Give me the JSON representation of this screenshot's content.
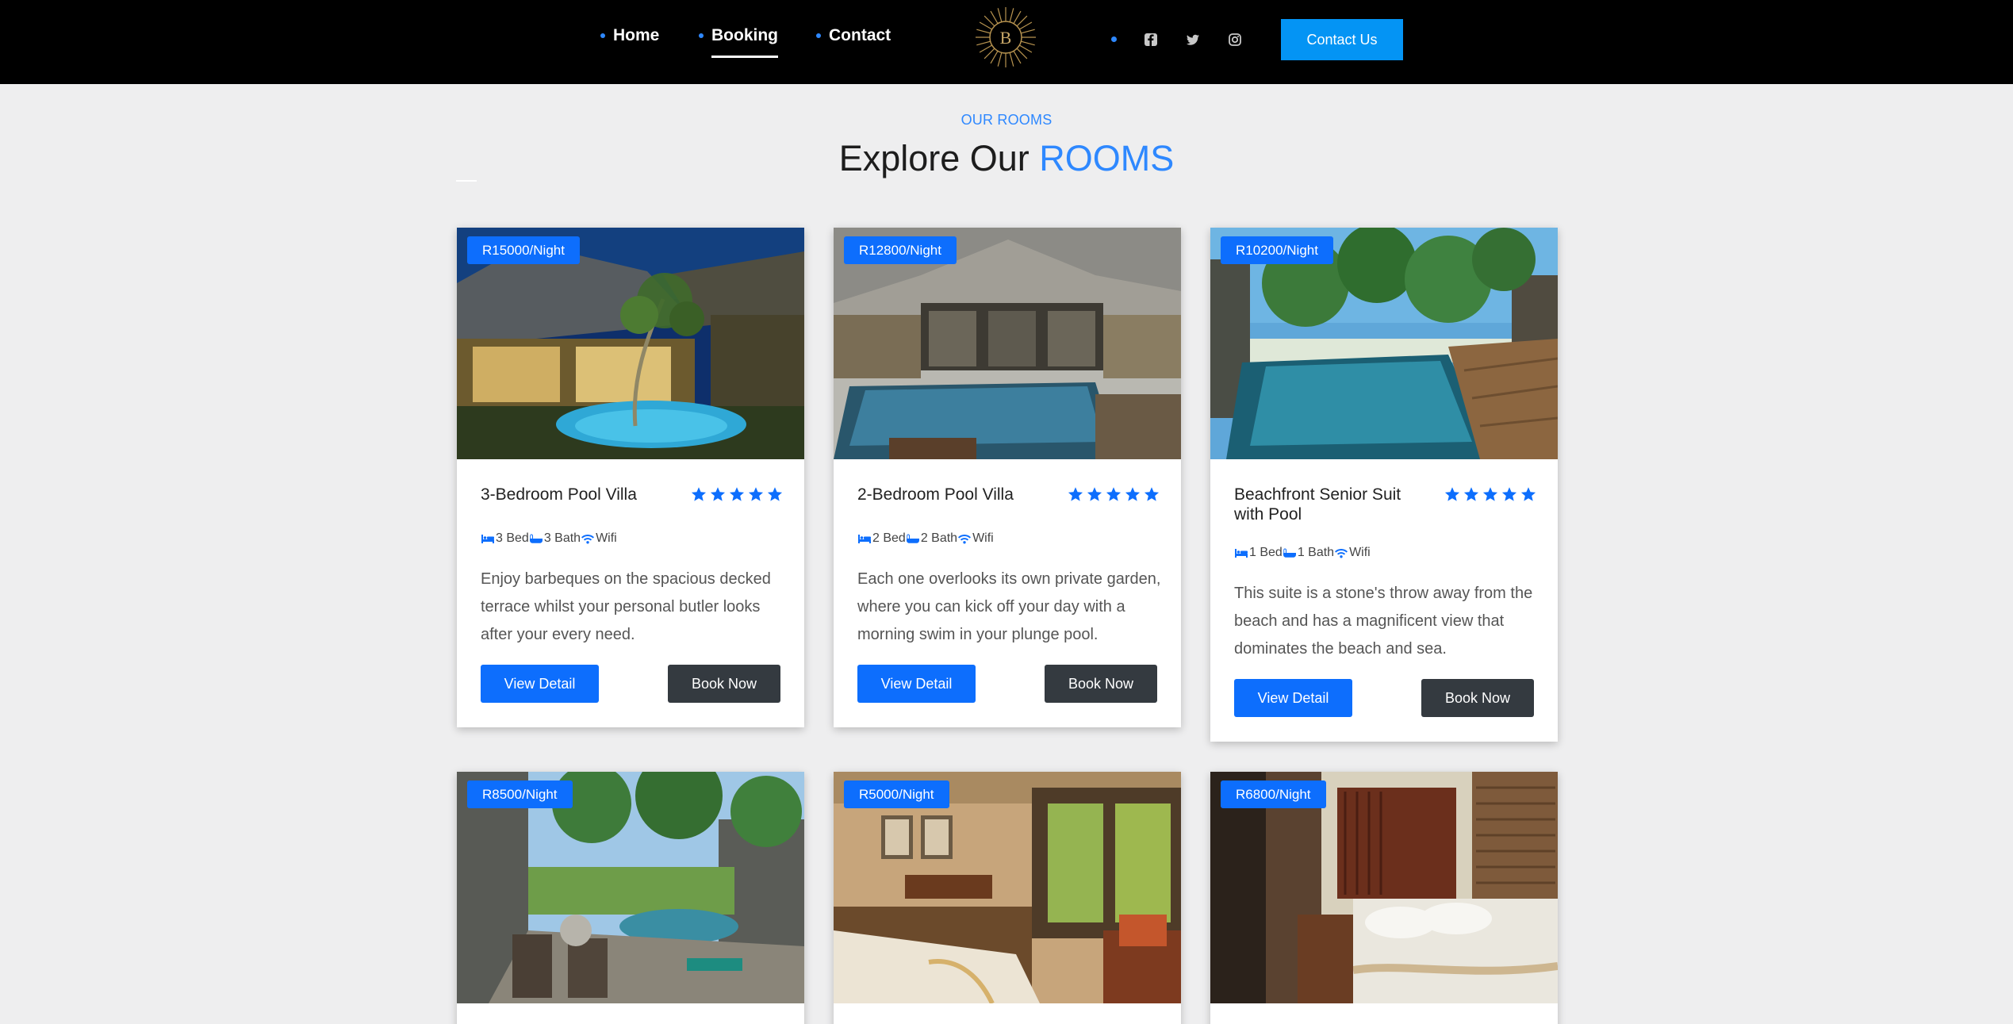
{
  "nav": {
    "links": [
      "Home",
      "Booking",
      "Contact"
    ],
    "active": "Booking",
    "logo_letter": "B",
    "contact_button": "Contact Us",
    "social_icons": [
      "facebook-icon",
      "twitter-icon",
      "instagram-icon"
    ]
  },
  "header": {
    "eyebrow": "OUR ROOMS",
    "title_prefix": "Explore Our ",
    "title_accent": "ROOMS"
  },
  "colors": {
    "accent": "#2e88ff",
    "primary_button": "#0d6efd",
    "dark_button": "#343a40",
    "contact_button": "#0494f4"
  },
  "rooms": [
    {
      "price": "R15000/Night",
      "title": "3-Bedroom Pool Villa",
      "rating": 5,
      "amenities": {
        "bed": "3 Bed",
        "bath": "3 Bath",
        "wifi": "Wifi"
      },
      "description": "Enjoy barbeques on the spacious decked terrace whilst your personal butler looks after your every need.",
      "detail_label": "View Detail",
      "book_label": "Book Now"
    },
    {
      "price": "R12800/Night",
      "title": "2-Bedroom Pool Villa",
      "rating": 5,
      "amenities": {
        "bed": "2 Bed",
        "bath": "2 Bath",
        "wifi": "Wifi"
      },
      "description": "Each one overlooks its own private garden, where you can kick off your day with a morning swim in your plunge pool.",
      "detail_label": "View Detail",
      "book_label": "Book Now"
    },
    {
      "price": "R10200/Night",
      "title": "Beachfront Senior Suit with Pool",
      "rating": 5,
      "amenities": {
        "bed": "1 Bed",
        "bath": "1 Bath",
        "wifi": "Wifi"
      },
      "description": "This suite is a stone's throw away from the beach and has a magnificent view that dominates the beach and sea.",
      "detail_label": "View Detail",
      "book_label": "Book Now"
    },
    {
      "price": "R8500/Night"
    },
    {
      "price": "R5000/Night"
    },
    {
      "price": "R6800/Night"
    }
  ]
}
